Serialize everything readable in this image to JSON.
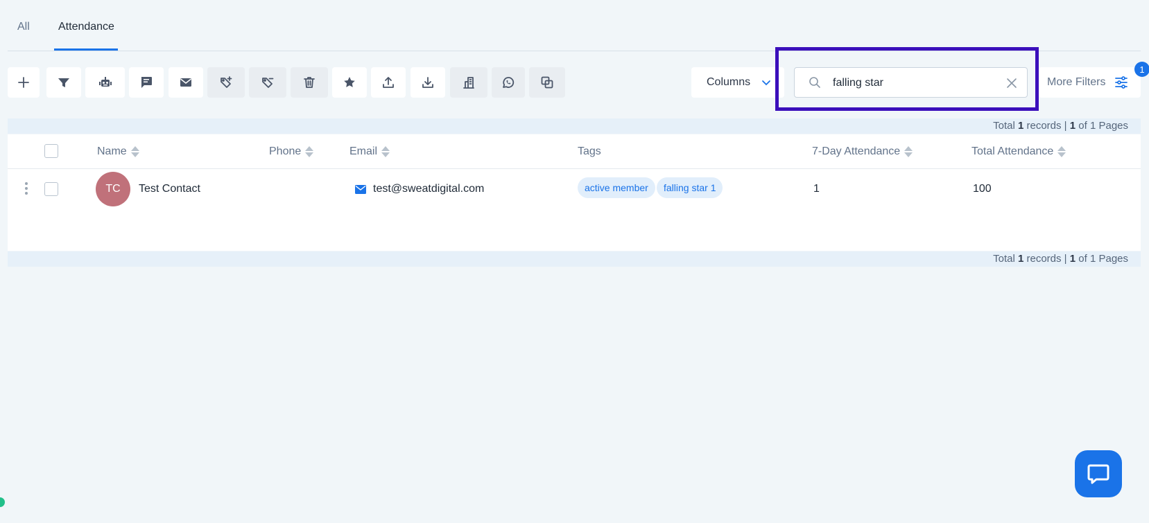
{
  "tabs": [
    {
      "label": "All"
    },
    {
      "label": "Attendance"
    }
  ],
  "toolbar": {
    "buttons": [
      {
        "icon": "plus-icon"
      },
      {
        "icon": "filter-icon"
      },
      {
        "icon": "robot-icon"
      },
      {
        "icon": "chat-icon"
      },
      {
        "icon": "mail-icon"
      },
      {
        "icon": "tag-add-icon"
      },
      {
        "icon": "tag-remove-icon"
      },
      {
        "icon": "trash-icon"
      },
      {
        "icon": "star-icon"
      },
      {
        "icon": "upload-icon"
      },
      {
        "icon": "download-icon"
      },
      {
        "icon": "building-icon"
      },
      {
        "icon": "whatsapp-icon"
      },
      {
        "icon": "duplicate-icon"
      }
    ],
    "columns_label": "Columns",
    "search_value": "falling star",
    "more_filters_label": "More Filters",
    "filter_count": "1"
  },
  "summary": {
    "prefix": "Total",
    "records": "1",
    "records_label": "records |",
    "page": "1",
    "of_label": "of 1 Pages"
  },
  "table": {
    "columns": [
      "Name",
      "Phone",
      "Email",
      "Tags",
      "7-Day Attendance",
      "Total Attendance"
    ],
    "rows": [
      {
        "initials": "TC",
        "name": "Test Contact",
        "phone": "",
        "email": "test@sweatdigital.com",
        "tags": [
          "active member",
          "falling star 1"
        ],
        "attendance_7day": "1",
        "attendance_total": "100"
      }
    ]
  },
  "colors": {
    "accent": "#1a73e8",
    "highlight": "#3b0fbb",
    "avatar": "#c0717a",
    "background": "#f1f6f9"
  }
}
